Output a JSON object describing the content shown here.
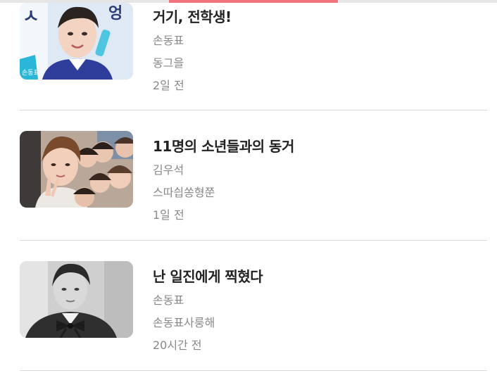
{
  "stories": [
    {
      "title": "거기, 전학생!",
      "author": "손동표",
      "tag": "동그을",
      "time": "2일 전",
      "thumb_icon": "boy-portrait-thumbnail"
    },
    {
      "title": "11명의 소년들과의 동거",
      "author": "김우석",
      "tag": "스따싑쏭형쭌",
      "time": "1일 전",
      "thumb_icon": "group-selfie-thumbnail"
    },
    {
      "title": "난 일진에게 찍혔다",
      "author": "손동표",
      "tag": "손동표사룽해",
      "time": "20시간 전",
      "thumb_icon": "grayscale-portrait-thumbnail"
    }
  ],
  "colors": {
    "scroll_indicator": "#f2747d",
    "title_text": "#222222",
    "meta_text": "#888888",
    "divider": "#d9d9d9"
  }
}
